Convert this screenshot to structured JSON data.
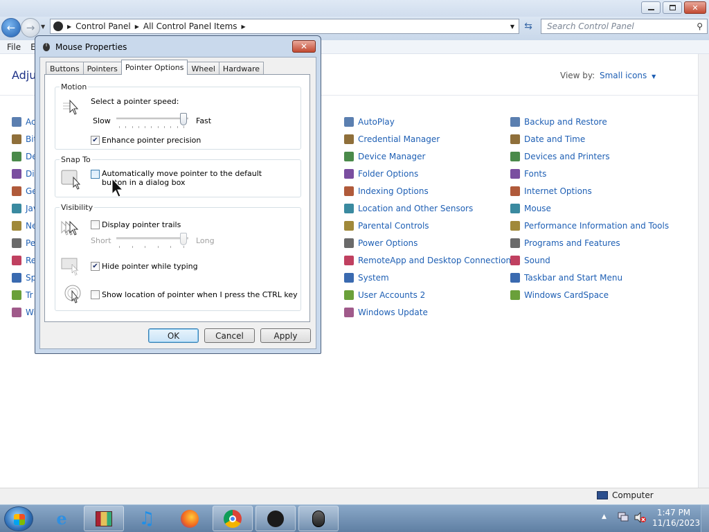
{
  "explorer": {
    "address_path": [
      "Control Panel",
      "All Control Panel Items"
    ],
    "search_placeholder": "Search Control Panel",
    "menu": [
      "File",
      "E"
    ],
    "heading": "Adju",
    "view_by_label": "View by:",
    "view_by_value": "Small icons",
    "left_items": [
      "Ac",
      "Bit",
      "De",
      "Dis",
      "Ge",
      "Jav",
      "Ne",
      "Pe",
      "Re",
      "Sp",
      "Tr",
      "Wi"
    ],
    "col2_items": [
      "AutoPlay",
      "Credential Manager",
      "Device Manager",
      "Folder Options",
      "Indexing Options",
      "Location and Other Sensors",
      "Parental Controls",
      "Power Options",
      "RemoteApp and Desktop Connections",
      "System",
      "User Accounts 2",
      "Windows Update"
    ],
    "col3_items": [
      "Backup and Restore",
      "Date and Time",
      "Devices and Printers",
      "Fonts",
      "Internet Options",
      "Mouse",
      "Performance Information and Tools",
      "Programs and Features",
      "Sound",
      "Taskbar and Start Menu",
      "Windows CardSpace"
    ],
    "status_computer": "Computer"
  },
  "dialog": {
    "title": "Mouse Properties",
    "tabs": [
      "Buttons",
      "Pointers",
      "Pointer Options",
      "Wheel",
      "Hardware"
    ],
    "active_tab": "Pointer Options",
    "motion": {
      "title": "Motion",
      "speed_label": "Select a pointer speed:",
      "slow": "Slow",
      "fast": "Fast",
      "speed_level": 1.0,
      "precision_label": "Enhance pointer precision",
      "precision_checked": true
    },
    "snap_to": {
      "title": "Snap To",
      "label": "Automatically move pointer to the default button in a dialog box",
      "checked": false
    },
    "visibility": {
      "title": "Visibility",
      "trails_label": "Display pointer trails",
      "trails_checked": false,
      "short": "Short",
      "long": "Long",
      "trail_level": 1.0,
      "hide_label": "Hide pointer while typing",
      "hide_checked": true,
      "ctrl_label": "Show location of pointer when I press the CTRL key",
      "ctrl_checked": false
    },
    "buttons": {
      "ok": "OK",
      "cancel": "Cancel",
      "apply": "Apply"
    }
  },
  "taskbar": {
    "time": "1:47 PM",
    "date": "11/16/2023"
  },
  "colors": {
    "link": "#1e5fb4",
    "heading": "#1e3287",
    "dialog_frame": "#c9d9ec"
  }
}
